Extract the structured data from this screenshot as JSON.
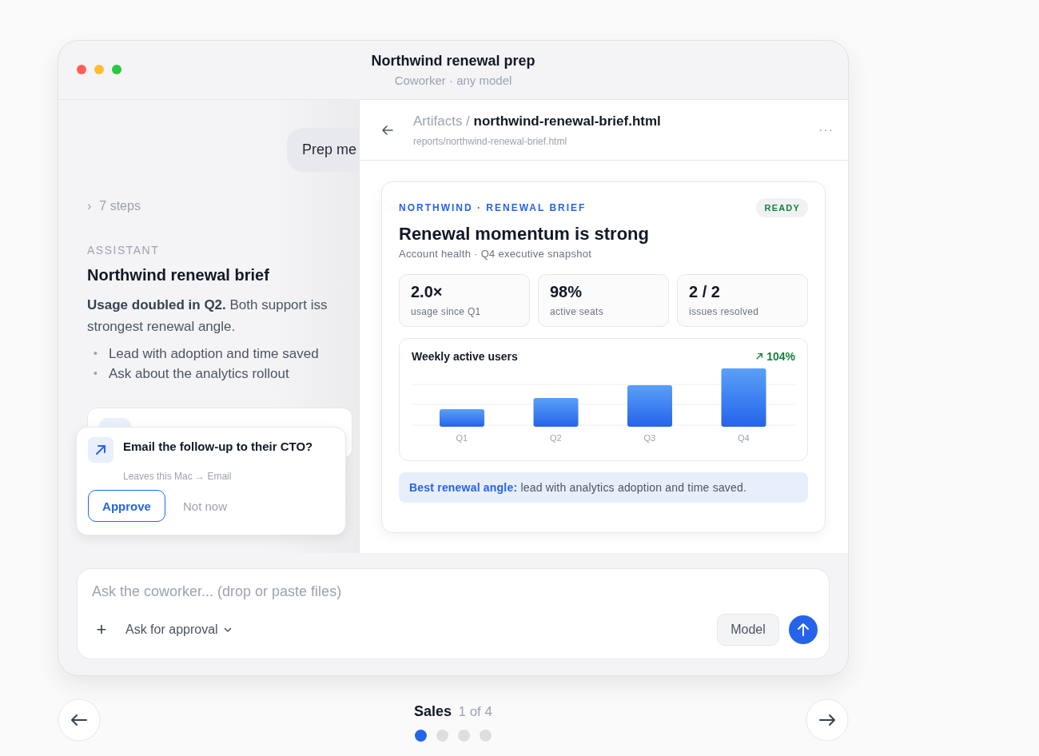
{
  "window": {
    "title": "Northwind renewal prep",
    "subtitle": "Coworker · any model"
  },
  "chat": {
    "user_message": "Prep me",
    "steps_toggle": "›",
    "steps": "7 steps",
    "role": "ASSISTANT",
    "heading": "Northwind renewal brief",
    "paragraph": "**Usage doubled in Q2.** Both support iss\nstrongest renewal angle.",
    "bullets": [
      {
        "marker": "•",
        "text": "Lead with adoption and time saved"
      },
      {
        "marker": "•",
        "text": "Ask about the analytics rollout"
      }
    ]
  },
  "approval": {
    "question": "Email the follow-up to their CTO?",
    "detail": "Leaves this Mac → Email",
    "approve": "Approve",
    "dismiss": "Not now"
  },
  "artifact": {
    "crumb": "Artifacts /",
    "file": "northwind-renewal-brief.html",
    "path": "reports/northwind-renewal-brief.html",
    "menu": "···",
    "eyebrow": "NORTHWIND · RENEWAL BRIEF",
    "status": "READY",
    "title": "Renewal momentum is strong",
    "subtitle": "Account health · Q4 executive snapshot",
    "stats": [
      {
        "value": "2.0×",
        "label": "usage since Q1"
      },
      {
        "value": "98%",
        "label": "active seats"
      },
      {
        "value": "2 / 2",
        "label": "issues resolved"
      }
    ],
    "chart": {
      "title": "Weekly active users",
      "change": "104%",
      "bar_labels": [
        "Q1",
        "Q2",
        "Q3",
        "Q4"
      ]
    },
    "callout": "**Best renewal angle:** lead with analytics adoption and time saved."
  },
  "composer": {
    "placeholder": "Ask the coworker... (drop or paste files)",
    "add": "+",
    "approval_mode": "Ask for approval",
    "model": "Model"
  },
  "pager": {
    "section": "Sales",
    "position": "1 of 4",
    "dots": [
      {
        "selected": true
      },
      {
        "selected": false
      },
      {
        "selected": false
      },
      {
        "selected": false
      }
    ]
  }
}
